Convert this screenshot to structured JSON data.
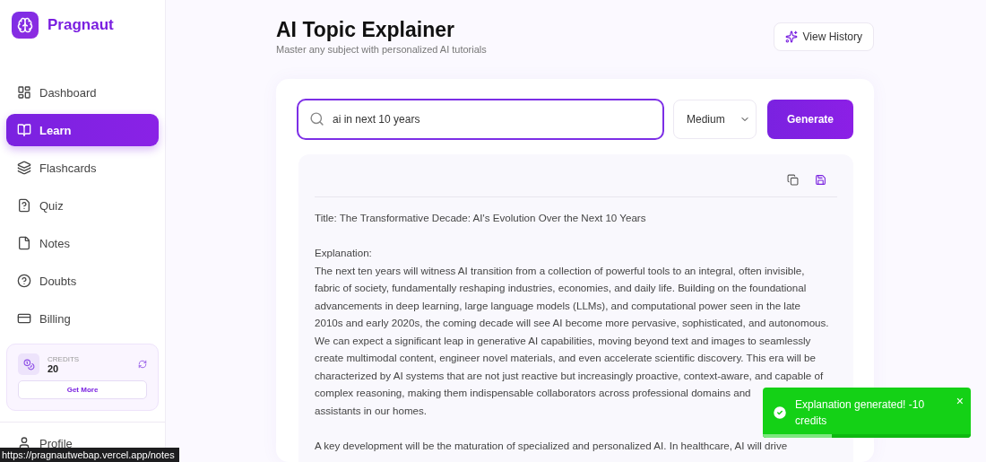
{
  "brand": {
    "name": "Pragnaut"
  },
  "sidebar": {
    "items": [
      {
        "label": "Dashboard",
        "selected": false
      },
      {
        "label": "Learn",
        "selected": true
      },
      {
        "label": "Flashcards",
        "selected": false
      },
      {
        "label": "Quiz",
        "selected": false
      },
      {
        "label": "Notes",
        "selected": false
      },
      {
        "label": "Doubts",
        "selected": false
      },
      {
        "label": "Billing",
        "selected": false
      }
    ],
    "credits": {
      "label": "CREDITS",
      "value": "20",
      "button": "Get More"
    },
    "profile": {
      "label": "Profile"
    }
  },
  "header": {
    "title": "AI Topic Explainer",
    "subtitle": "Master any subject with personalized AI tutorials",
    "history_button": "View History"
  },
  "form": {
    "topic": {
      "value": "ai in next 10 years"
    },
    "level": {
      "value": "Medium"
    },
    "generate_button": "Generate"
  },
  "result": {
    "lines": [
      {
        "kind": "line",
        "text": "Title: The Transformative Decade: AI's Evolution Over the Next 10 Years"
      },
      {
        "kind": "blank"
      },
      {
        "kind": "line",
        "text": "Explanation:"
      },
      {
        "kind": "line",
        "text": "The next ten years will witness AI transition from a collection of powerful tools to an integral, often invisible,"
      },
      {
        "kind": "line",
        "text": "fabric of society, fundamentally reshaping industries, economies, and daily life. Building on the foundational"
      },
      {
        "kind": "line",
        "text": "advancements in deep learning, large language models (LLMs), and computational power seen in the late"
      },
      {
        "kind": "line",
        "text": "2010s and early 2020s, the coming decade will see AI become more pervasive, sophisticated, and autonomous."
      },
      {
        "kind": "line",
        "text": "We can expect a significant leap in generative AI capabilities, moving beyond text and images to seamlessly"
      },
      {
        "kind": "line",
        "text": "create multimodal content, engineer novel materials, and even accelerate scientific discovery. This era will be"
      },
      {
        "kind": "line",
        "text": "characterized by AI systems that are not just reactive but increasingly proactive, context-aware, and capable of"
      },
      {
        "kind": "line",
        "text": "complex reasoning, making them indispensable collaborators across professional domains and"
      },
      {
        "kind": "line",
        "text": "assistants in our homes."
      },
      {
        "kind": "blank"
      },
      {
        "kind": "line",
        "text": "A key development will be the maturation of specialized and personalized AI. In healthcare, AI will drive"
      }
    ]
  },
  "toast": {
    "message": "Explanation generated! -10 credits",
    "close": "×",
    "level": 0.33
  },
  "status_url": "https://pragnautwebap.vercel.app/notes"
}
